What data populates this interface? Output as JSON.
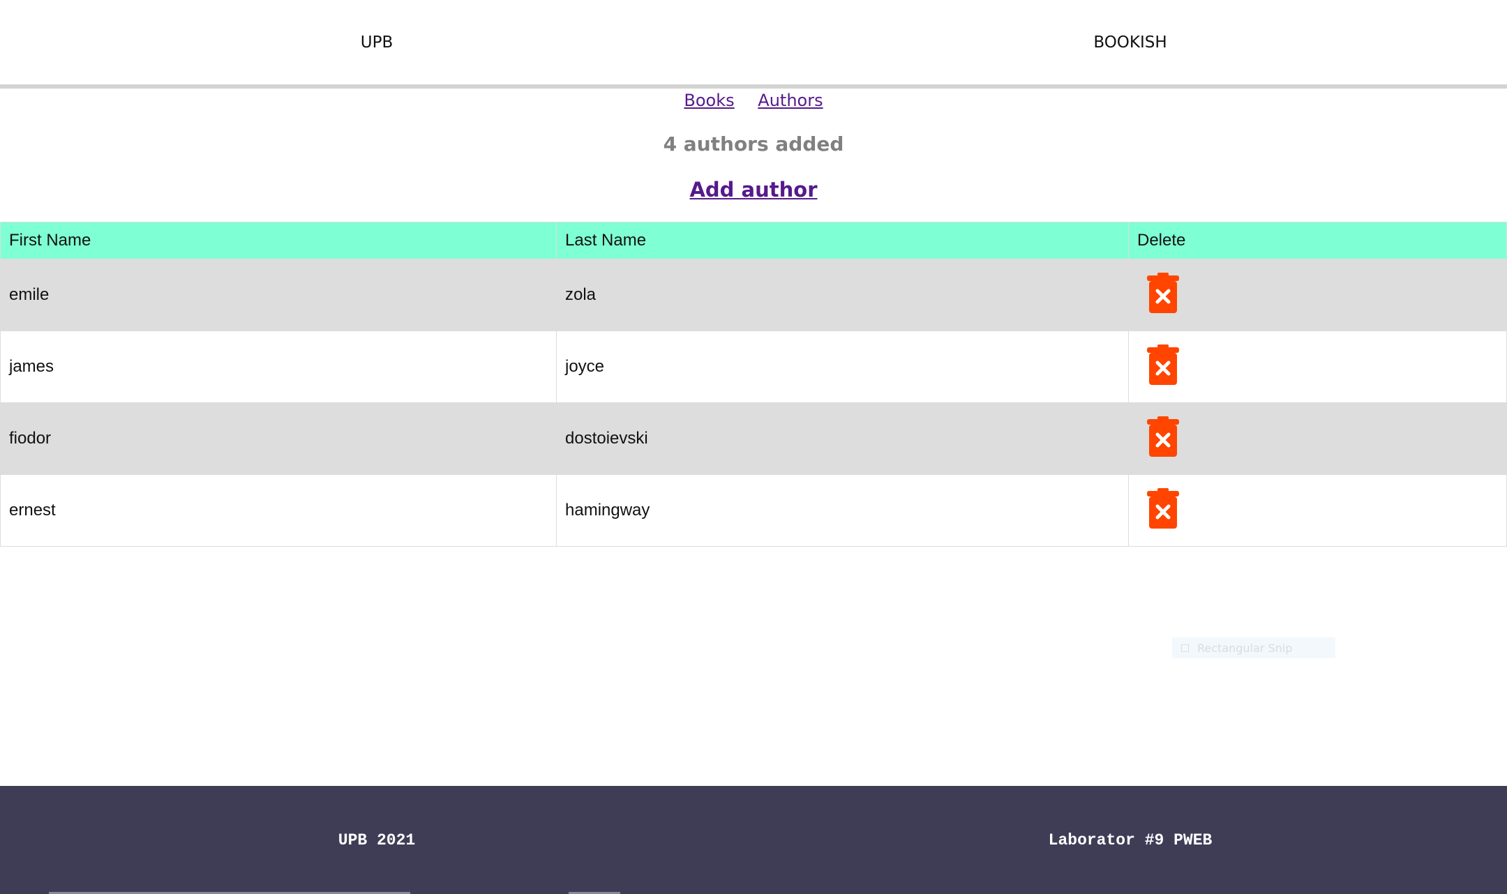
{
  "header": {
    "left_title": "UPB",
    "right_title": "BOOKISH"
  },
  "nav": {
    "books": "Books",
    "authors": "Authors"
  },
  "summary": {
    "count_text": "4 authors added",
    "add_link": "Add author"
  },
  "table": {
    "columns": [
      "First Name",
      "Last Name",
      "Delete"
    ],
    "rows": [
      {
        "first": "emile",
        "last": "zola"
      },
      {
        "first": "james",
        "last": "joyce"
      },
      {
        "first": "fiodor",
        "last": "dostoievski"
      },
      {
        "first": "ernest",
        "last": "hamingway"
      }
    ],
    "delete_icon": "trash-delete-icon",
    "delete_color": "#ff4500"
  },
  "overlay": {
    "snip_label": "Rectangular Snip"
  },
  "footer": {
    "left": "UPB 2021",
    "right": "Laborator #9 PWEB"
  },
  "colors": {
    "header_row": "#7fffd4",
    "odd_row": "#dddddd",
    "footer_bg": "#3f3d56",
    "link": "#551a8b"
  }
}
